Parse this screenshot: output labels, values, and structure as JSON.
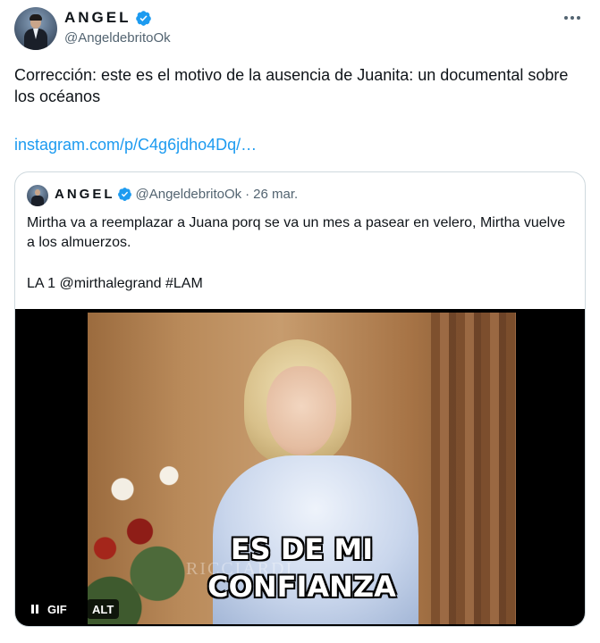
{
  "post": {
    "author_name": "ANGEL",
    "author_handle": "@AngeldebritoOk",
    "text": "Corrección: este es el motivo de la ausencia de Juanita: un documental sobre los océanos",
    "link": "instagram.com/p/C4g6jdho4Dq/…"
  },
  "quoted": {
    "author_name": "ANGEL",
    "author_handle": "@AngeldebritoOk",
    "separator": "·",
    "date": "26 mar.",
    "text": "Mirtha va a reemplazar a Juana porq se va un mes a pasear en velero, Mirtha vuelve a los almuerzos.",
    "tags": "LA 1 @mirthalegrand #LAM",
    "media": {
      "caption_line1": "ES DE MI",
      "caption_line2": "CONFIANZA",
      "watermark": "RICCIARDI",
      "gif_label": "GIF",
      "alt_label": "ALT"
    }
  },
  "icons": [
    "more-icon",
    "verified-icon",
    "pause-icon"
  ],
  "colors": {
    "link": "#1d9bf0",
    "secondary_text": "#536471",
    "border": "#cfd9de",
    "verified": "#1d9bf0"
  }
}
